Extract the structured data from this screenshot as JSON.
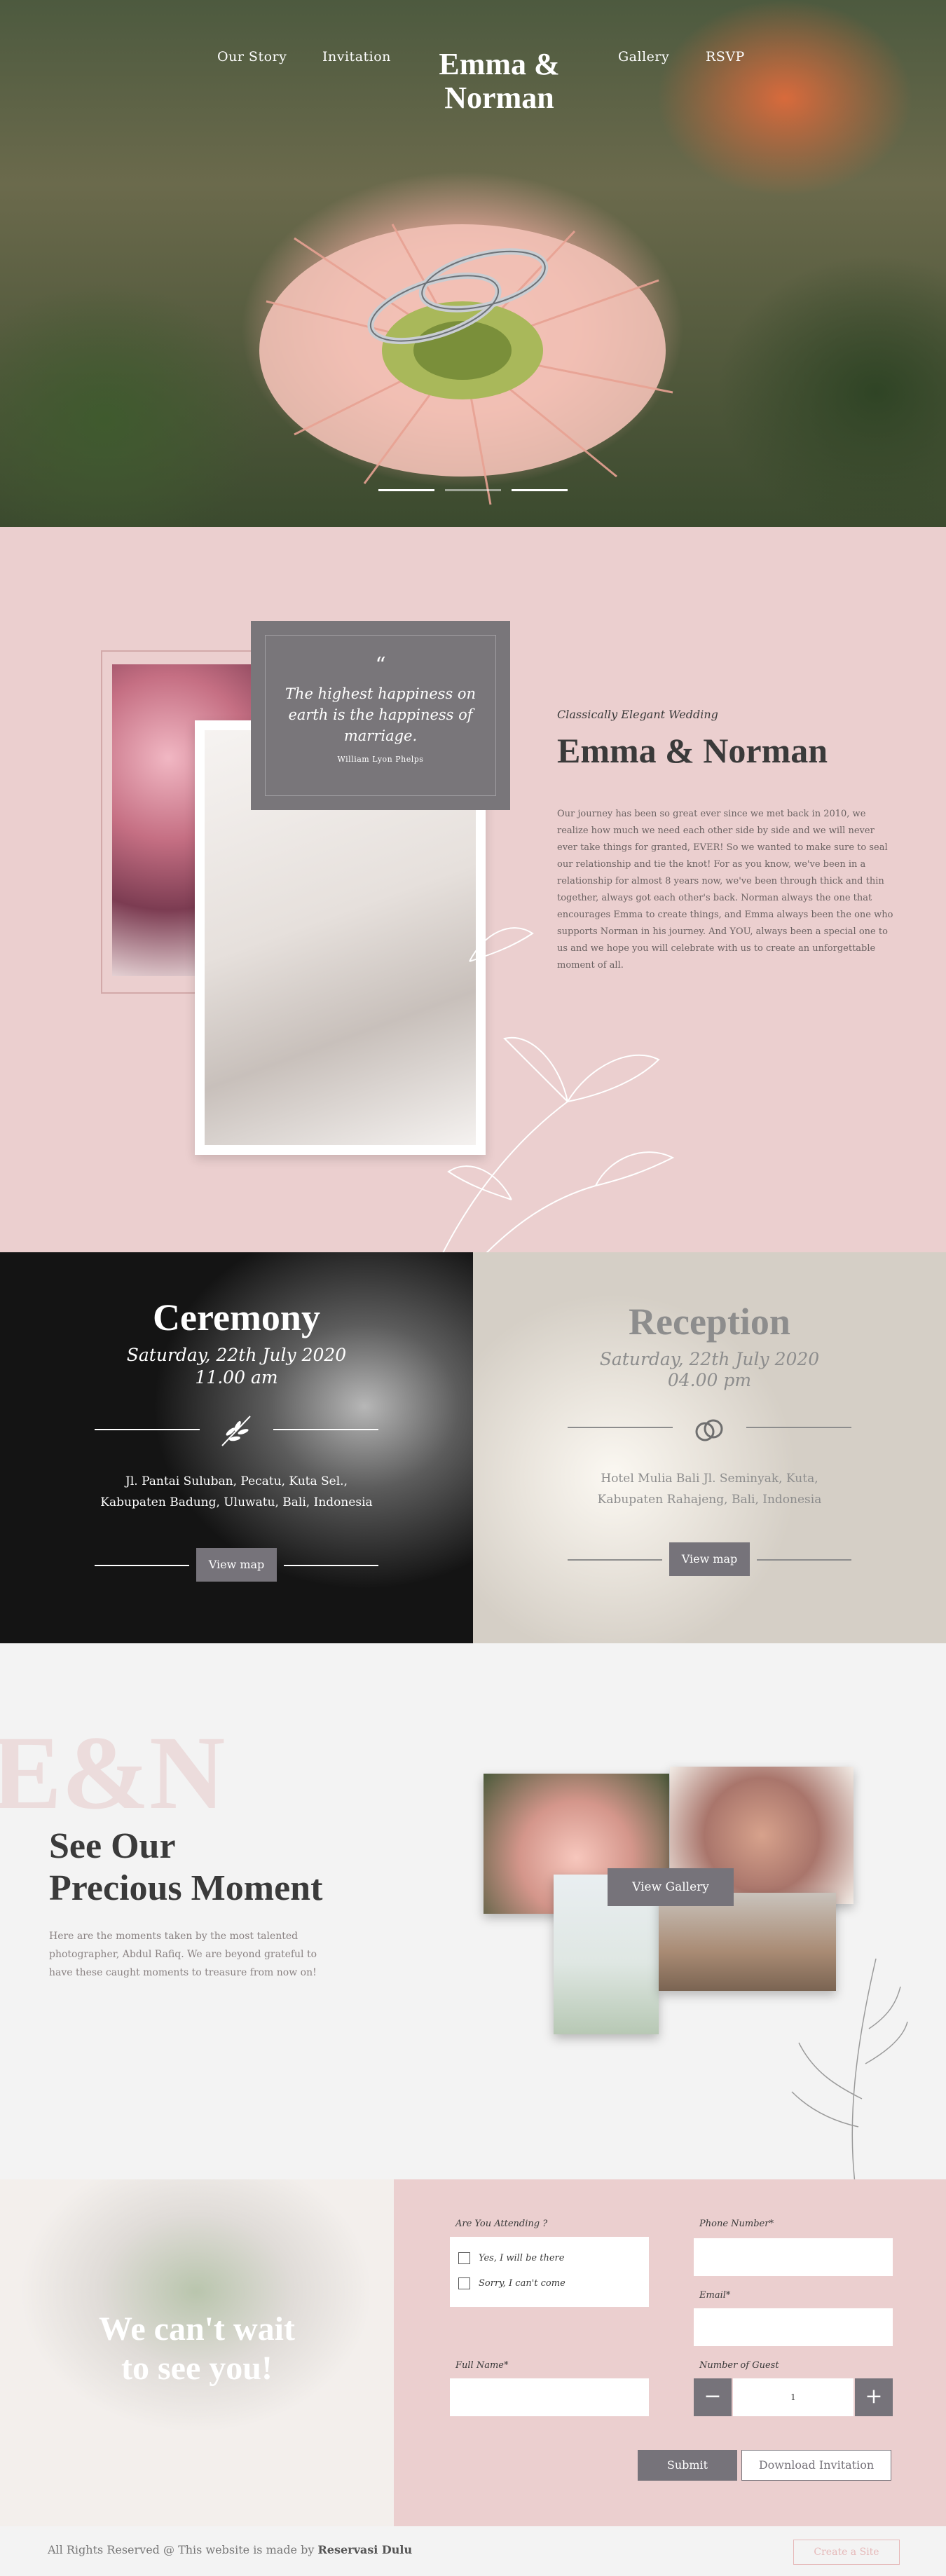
{
  "nav": {
    "left": [
      "Our Story",
      "Invitation"
    ],
    "right": [
      "Gallery",
      "RSVP"
    ],
    "brand_line1": "Emma &",
    "brand_line2": "Norman"
  },
  "quote": {
    "mark": "“",
    "text": "The highest happiness on earth is the happiness of marriage.",
    "author": "William Lyon Phelps"
  },
  "about": {
    "kicker": "Classically Elegant Wedding",
    "title": "Emma & Norman",
    "body": "Our journey has been so great ever since we met back in 2010, we realize how much we need each other side by side and we will never ever take things for granted, EVER! So we wanted to make sure to seal our relationship and tie the knot! For as you know, we've been in a relationship for almost 8 years now, we've been through thick and thin together, always got each other's back. Norman always the one that encourages Emma to create things, and Emma always been the one who supports Norman in his journey. And YOU, always been a special one to us and we hope you will celebrate with us to create an unforgettable moment of all."
  },
  "ceremony": {
    "title": "Ceremony",
    "date": "Saturday, 22th July 2020",
    "time": "11.00 am",
    "address": "Jl. Pantai Suluban, Pecatu, Kuta Sel., Kabupaten Badung, Uluwatu, Bali, Indonesia",
    "button": "View map"
  },
  "reception": {
    "title": "Reception",
    "date": "Saturday, 22th July 2020",
    "time": "04.00 pm",
    "address": "Hotel Mulia Bali Jl. Seminyak, Kuta, Kabupaten Rahajeng, Bali, Indonesia",
    "button": "View map"
  },
  "gallery": {
    "bg_text": "E&N",
    "title_line1": "See Our",
    "title_line2": "Precious Moment",
    "body": "Here are the moments taken by the most talented photographer, Abdul Rafiq. We are beyond grateful to have these caught moments to treasure from now on!",
    "button": "View Gallery"
  },
  "rsvp": {
    "headline_line1": "We can't wait",
    "headline_line2": "to see you!",
    "attending_label": "Are You Attending ?",
    "option_yes": "Yes, I will be there",
    "option_no": "Sorry, I can't come",
    "full_name_label": "Full Name*",
    "phone_label": "Phone Number*",
    "email_label": "Email*",
    "guest_label": "Number of Guest",
    "guest_value": "1",
    "minus": "−",
    "plus": "+",
    "submit": "Submit",
    "download": "Download Invitation"
  },
  "footer": {
    "text": "All Rights Reserved @ This website is made by",
    "brand": "Reservasi Dulu",
    "button": "Create a Site"
  },
  "colors": {
    "accent": "#76737a",
    "pink": "#ebcfcf",
    "text": "#3a3a3a"
  }
}
